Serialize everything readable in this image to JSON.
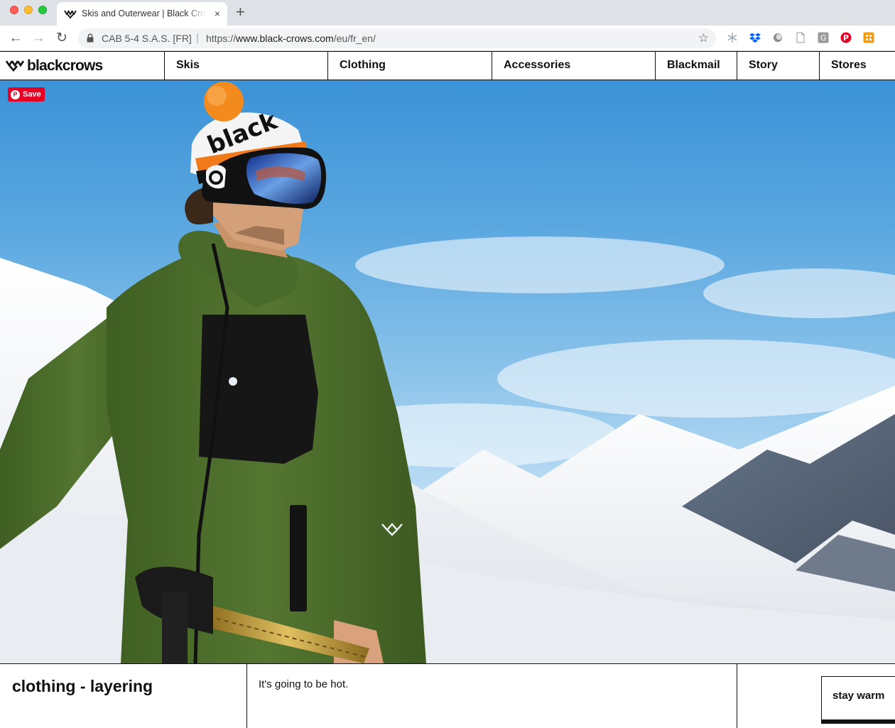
{
  "browser": {
    "tab_title": "Skis and Outerwear | Black Crows",
    "tab_close": "×",
    "new_tab": "+",
    "site_identity": "CAB 5-4 S.A.S. [FR]",
    "url_separator": "|",
    "url_scheme": "https://",
    "url_host": "www.black-crows.com",
    "url_path": "/eu/fr_en/",
    "nav_back": "←",
    "nav_forward": "→",
    "nav_reload": "↻",
    "star": "☆",
    "extensions": [
      "snowflake-icon",
      "dropbox-icon",
      "circle-ext-icon",
      "page-icon",
      "g-ext-icon",
      "pinterest-icon",
      "orange-ext-icon"
    ]
  },
  "site": {
    "logo_text": "blackcrows",
    "nav": [
      {
        "label": "Skis"
      },
      {
        "label": "Clothing"
      },
      {
        "label": "Accessories"
      },
      {
        "label": "Blackmail"
      },
      {
        "label": "Story"
      },
      {
        "label": "Stores"
      }
    ]
  },
  "hero": {
    "pin_logo": "P",
    "save_label": "Save",
    "beanie_text": "black"
  },
  "strip": {
    "category_title": "clothing - layering",
    "tagline": "It's going to be hot.",
    "cta_label": "stay warm"
  },
  "colors": {
    "accent": "#111111",
    "pinterest": "#e60023",
    "jacket": "#4c6b2e",
    "sky": "#5aa7e0"
  }
}
